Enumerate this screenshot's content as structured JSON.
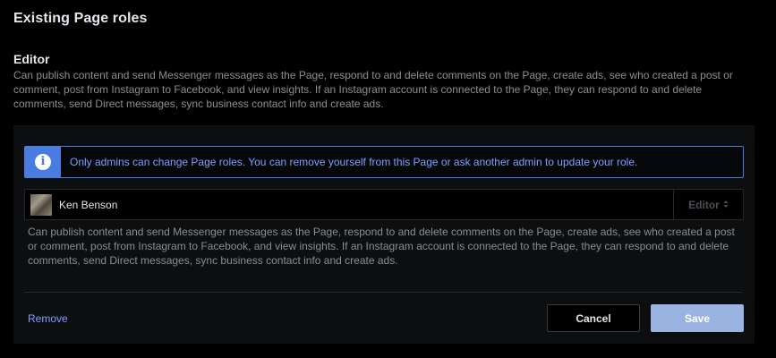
{
  "header": {
    "title": "Existing Page roles"
  },
  "role": {
    "name": "Editor",
    "description": "Can publish content and send Messenger messages as the Page, respond to and delete comments on the Page, create ads, see who created a post or comment, post from Instagram to Facebook, and view insights. If an Instagram account is connected to the Page, they can respond to and delete comments, send Direct messages, sync business contact info and create ads."
  },
  "notice": {
    "icon": "info-icon",
    "text": "Only admins can change Page roles. You can remove yourself from this Page or ask another admin to update your role."
  },
  "person": {
    "name": "Ken Benson",
    "role_value": "Editor",
    "role_description": "Can publish content and send Messenger messages as the Page, respond to and delete comments on the Page, create ads, see who created a post or comment, post from Instagram to Facebook, and view insights. If an Instagram account is connected to the Page, they can respond to and delete comments, send Direct messages, sync business contact info and create ads."
  },
  "actions": {
    "remove_label": "Remove",
    "cancel_label": "Cancel",
    "save_label": "Save"
  },
  "colors": {
    "accent": "#4a7be0",
    "link": "#7aa2ff",
    "save_disabled": "#9bb3e0",
    "background": "#000000",
    "panel": "#0d0e10"
  }
}
